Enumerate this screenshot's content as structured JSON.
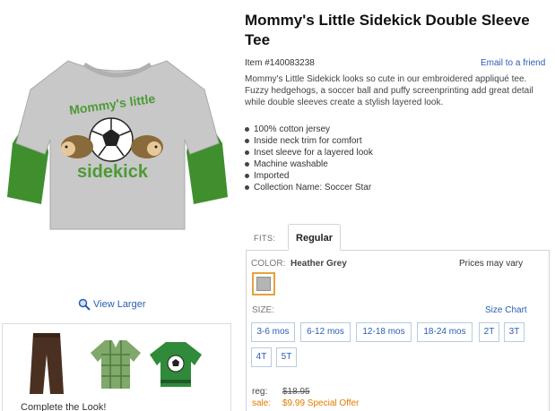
{
  "product": {
    "title": "Mommy's Little Sidekick Double Sleeve Tee",
    "item_number": "Item #140083238",
    "email_link": "Email to a friend",
    "description": "Mommy's Little Sidekick looks so cute in our embroidered appliqué tee. Fuzzy hedgehogs, a soccer ball and puffy screenprinting add great detail while double sleeves create a stylish layered look.",
    "features": [
      "100% cotton jersey",
      "Inside neck trim for comfort",
      "Inset sleeve for a layered look",
      "Machine washable",
      "Imported",
      "Collection Name: Soccer Star"
    ],
    "image_text": {
      "line1": "Mommy's little",
      "line2": "sidekick"
    }
  },
  "gallery": {
    "view_larger": "View Larger",
    "complete_look": "Complete the Look!"
  },
  "fits": {
    "label": "FITS:",
    "selected": "Regular"
  },
  "options": {
    "color_label": "COLOR:",
    "color_value": "Heather Grey",
    "price_note": "Prices may vary",
    "swatch_color": "#b4b4b4",
    "size_label": "SIZE:",
    "size_chart": "Size Chart",
    "sizes": [
      "3-6 mos",
      "6-12 mos",
      "12-18 mos",
      "18-24 mos",
      "2T",
      "3T",
      "4T",
      "5T"
    ]
  },
  "pricing": {
    "reg_label": "reg:",
    "reg_price": "$18.95",
    "sale_label": "sale:",
    "sale_price": "$9.99 Special Offer"
  },
  "colors": {
    "link": "#2a5db0",
    "sale": "#e07b00",
    "swatch_border": "#e6a33a",
    "shirt_grey": "#c8c8c8",
    "sleeve_green": "#3f8f2e"
  }
}
